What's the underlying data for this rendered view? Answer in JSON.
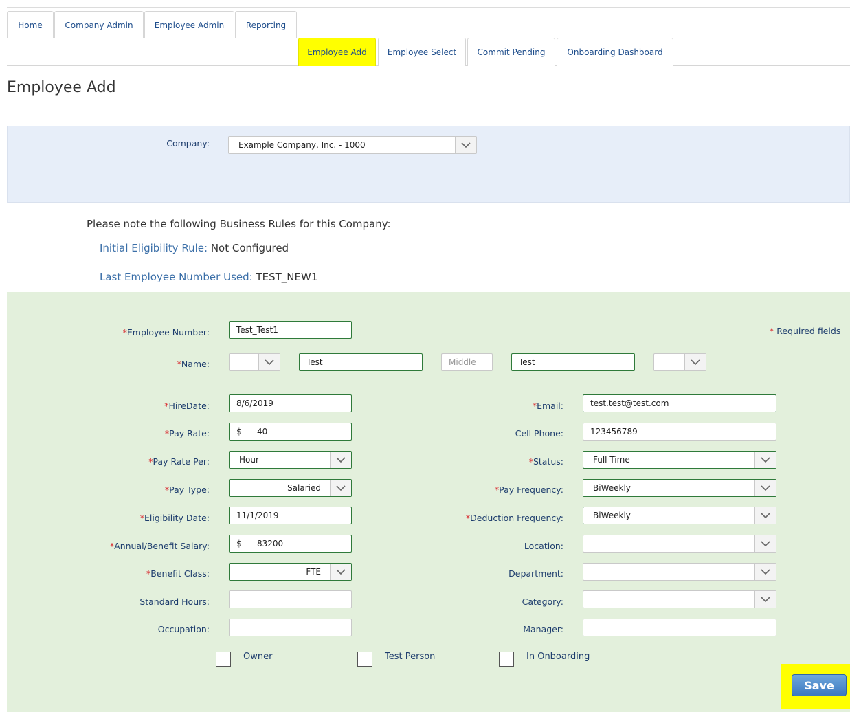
{
  "nav": {
    "tabs": [
      {
        "label": "Home"
      },
      {
        "label": "Company Admin"
      },
      {
        "label": "Employee Admin"
      },
      {
        "label": "Reporting"
      }
    ],
    "subtabs": [
      {
        "label": "Employee Add",
        "active": true
      },
      {
        "label": "Employee Select"
      },
      {
        "label": "Commit Pending"
      },
      {
        "label": "Onboarding Dashboard"
      }
    ]
  },
  "page_title": "Employee Add",
  "company": {
    "label": "Company:",
    "value": "Example Company, Inc. - 1000"
  },
  "business_rules": {
    "heading": "Please note the following Business Rules for this Company:",
    "eligibility_label": "Initial Eligibility Rule:",
    "eligibility_value": "Not Configured",
    "last_emp_label": "Last Employee Number Used:",
    "last_emp_value": "TEST_NEW1"
  },
  "form": {
    "required_note": "Required fields",
    "employee_number": {
      "label": "Employee Number:",
      "value": "Test_Test1"
    },
    "name": {
      "label": "Name:",
      "first": "Test",
      "middle_placeholder": "Middle",
      "last": "Test"
    },
    "hire_date": {
      "label": "HireDate:",
      "value": "8/6/2019"
    },
    "pay_rate": {
      "label": "Pay Rate:",
      "prefix": "$",
      "value": "40"
    },
    "pay_rate_per": {
      "label": "Pay Rate Per:",
      "value": "Hour"
    },
    "pay_type": {
      "label": "Pay Type:",
      "value": "Salaried"
    },
    "eligibility_date": {
      "label": "Eligibility Date:",
      "value": "11/1/2019"
    },
    "annual_salary": {
      "label": "Annual/Benefit Salary:",
      "prefix": "$",
      "value": "83200"
    },
    "benefit_class": {
      "label": "Benefit Class:",
      "value": "FTE"
    },
    "standard_hours": {
      "label": "Standard Hours:",
      "value": ""
    },
    "occupation": {
      "label": "Occupation:",
      "value": ""
    },
    "email": {
      "label": "Email:",
      "value": "test.test@test.com"
    },
    "cell_phone": {
      "label": "Cell Phone:",
      "value": "123456789"
    },
    "status": {
      "label": "Status:",
      "value": "Full Time"
    },
    "pay_frequency": {
      "label": "Pay Frequency:",
      "value": "BiWeekly"
    },
    "deduction_frequency": {
      "label": "Deduction Frequency:",
      "value": "BiWeekly"
    },
    "location": {
      "label": "Location:",
      "value": ""
    },
    "department": {
      "label": "Department:",
      "value": ""
    },
    "category": {
      "label": "Category:",
      "value": ""
    },
    "manager": {
      "label": "Manager:",
      "value": ""
    },
    "checkboxes": {
      "owner": "Owner",
      "test_person": "Test Person",
      "in_onboarding": "In Onboarding"
    },
    "save_label": "Save"
  },
  "icons": {
    "select_arrow": "chevron-down-icon"
  },
  "colors": {
    "highlight": "#ffff00",
    "required": "#d9262c",
    "link": "#3b6fa8",
    "form_bg": "#e3f0dc",
    "company_bg": "#e7eef9"
  }
}
